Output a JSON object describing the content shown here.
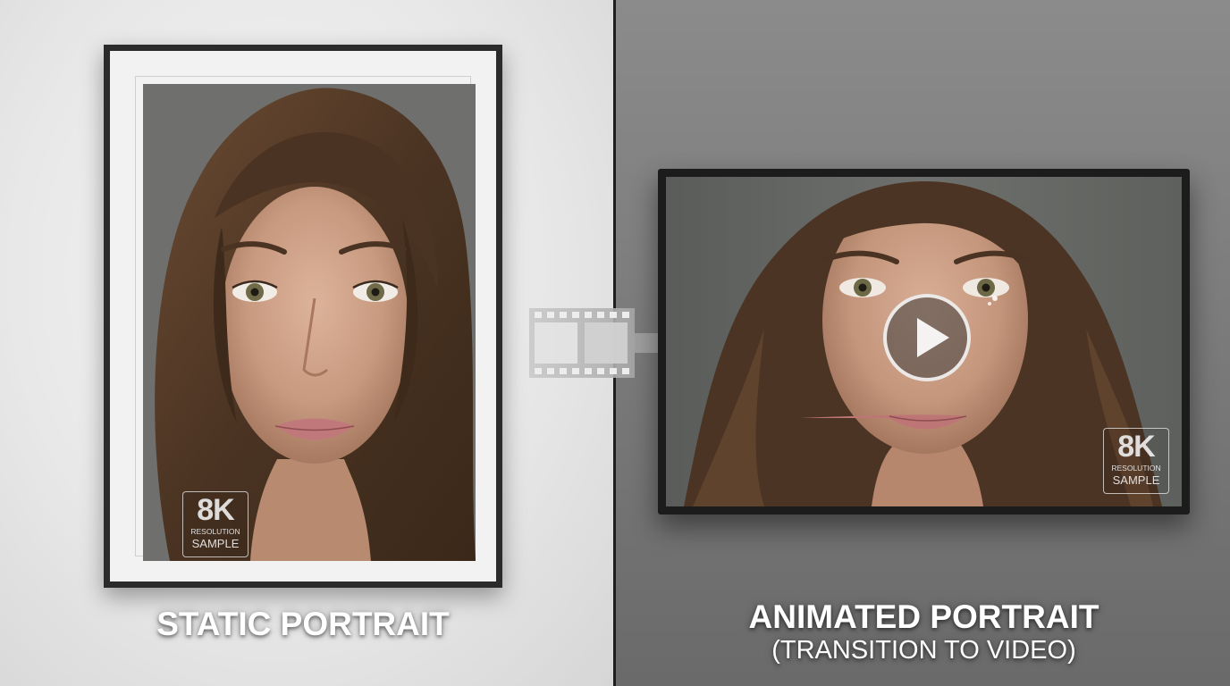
{
  "static_panel": {
    "caption": "STATIC PORTRAIT",
    "badge": {
      "main": "8K",
      "line1": "RESOLUTION",
      "line2": "SAMPLE"
    }
  },
  "animated_panel": {
    "caption_line1": "ANIMATED PORTRAIT",
    "caption_line2": "(TRANSITION TO VIDEO)",
    "badge": {
      "main": "8K",
      "line1": "RESOLUTION",
      "line2": "SAMPLE"
    }
  },
  "icons": [
    "film-strip-icon",
    "arrow-right-icon",
    "play-icon"
  ],
  "colors": {
    "left_background": "#ececec",
    "right_background": "#808080",
    "frame": "#2b2b2b",
    "mat": "#f2f2f2",
    "hair": "#5a3f2a",
    "skin": "#c89a80"
  }
}
